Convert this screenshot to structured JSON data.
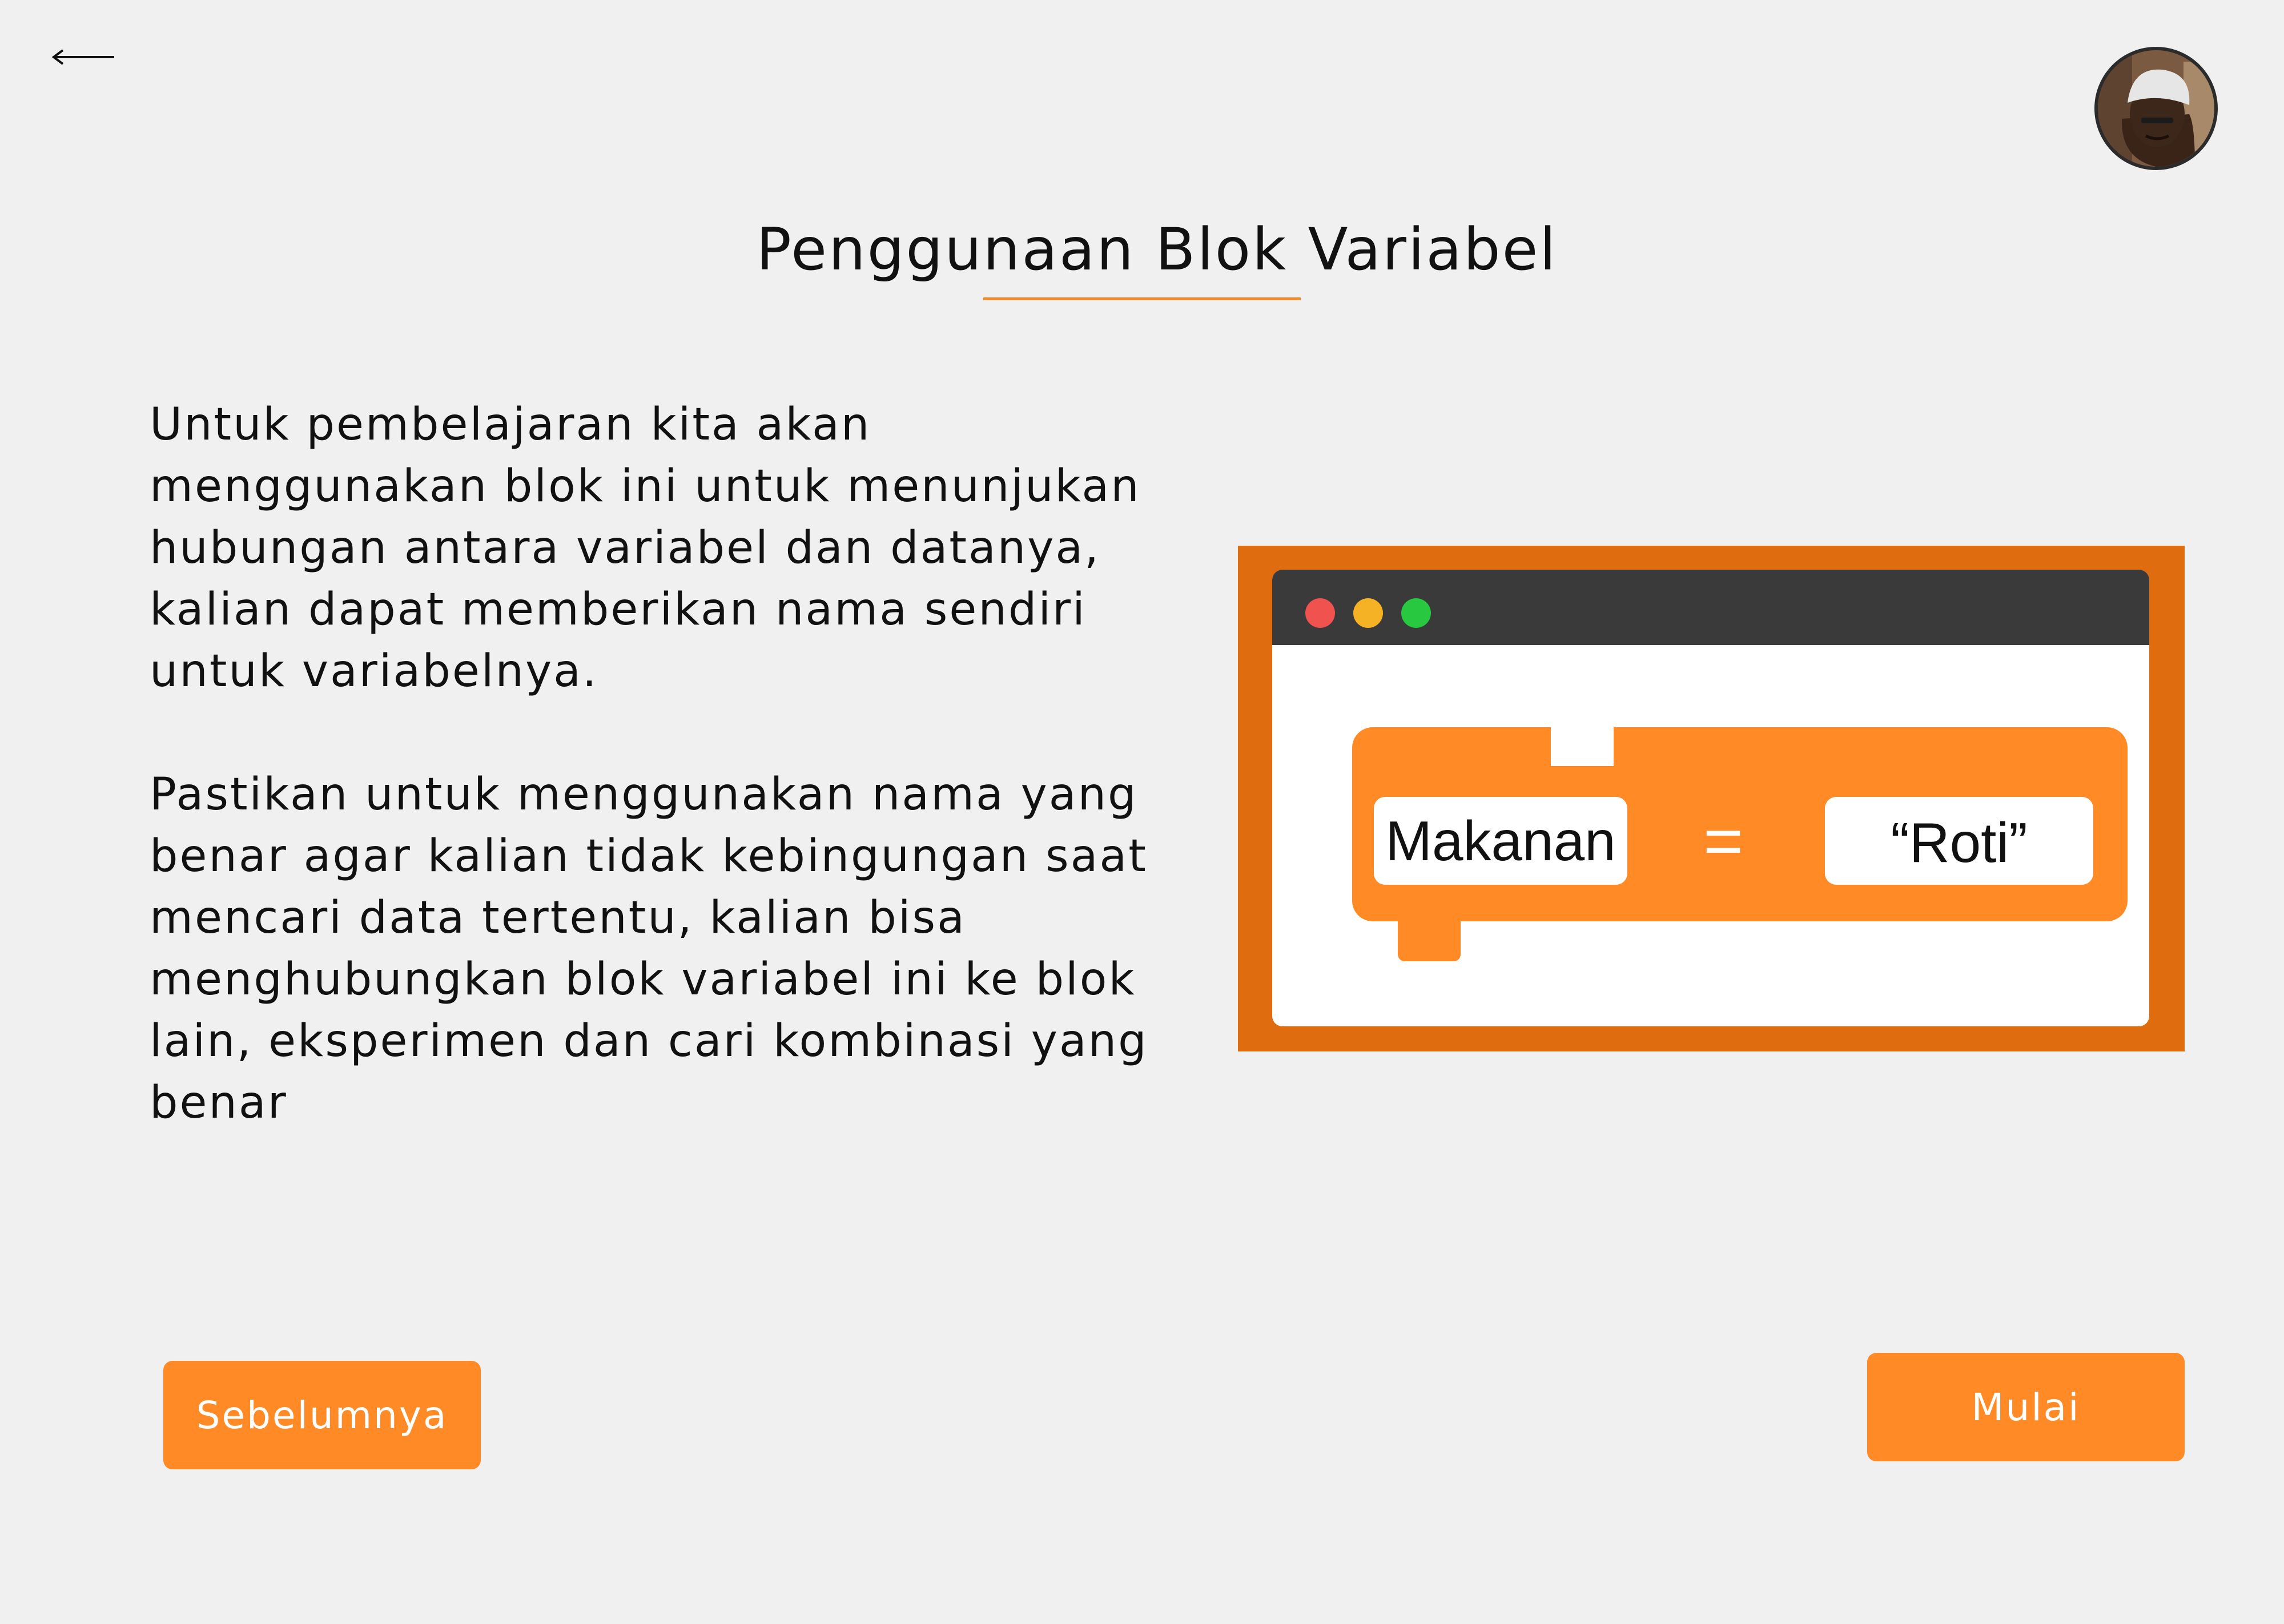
{
  "header": {
    "back_icon": "arrow-left-icon",
    "avatar_icon": "user-avatar"
  },
  "page": {
    "title": "Penggunaan Blok Variabel",
    "paragraphs": [
      "Untuk pembelajaran kita akan menggunakan blok ini untuk menunjukan hubungan antara variabel dan datanya, kalian dapat memberikan nama sendiri untuk variabelnya.",
      "Pastikan untuk menggunakan nama yang benar agar kalian tidak kebingungan saat mencari data tertentu, kalian bisa menghubungkan blok variabel ini ke blok lain, eksperimen dan cari kombinasi yang benar"
    ]
  },
  "illustration": {
    "variable_name": "Makanan",
    "operator": "=",
    "variable_value": "“Roti”",
    "colors": {
      "frame": "#e06c10",
      "block": "#ff8a26",
      "window_bar": "#3a3a3a",
      "dot_red": "#f0524f",
      "dot_yellow": "#f5b224",
      "dot_green": "#28c840"
    }
  },
  "buttons": {
    "prev_label": "Sebelumnya",
    "start_label": "Mulai"
  },
  "colors": {
    "accent": "#ff8a26",
    "background": "#f0f0f0"
  }
}
